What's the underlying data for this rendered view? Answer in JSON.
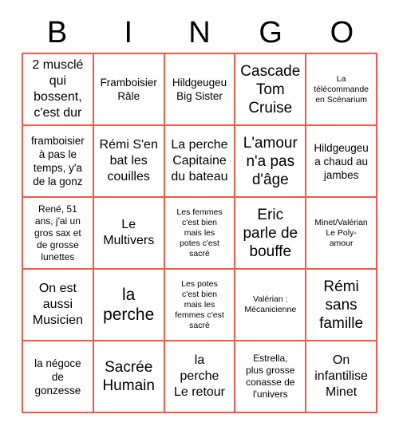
{
  "card": {
    "header_letters": [
      "B",
      "I",
      "N",
      "G",
      "O"
    ],
    "grid_border_color": "#f4564a",
    "text_color": "#000000",
    "background_color": "#ffffff",
    "columns": 5,
    "rows": 5,
    "cells": [
      {
        "text": "2 musclé\nqui\nbossent,\nc'est dur",
        "size": "sz-lg"
      },
      {
        "text": "Framboisier\nRâle",
        "size": "sz-md"
      },
      {
        "text": "Hildgeugeu\nBig Sister",
        "size": "sz-md"
      },
      {
        "text": "Cascade\nTom\nCruise",
        "size": "sz-xl"
      },
      {
        "text": "La\ntélécommande\nen Scénarium",
        "size": "sz-xs"
      },
      {
        "text": "framboisier\nà pas le\ntemps, y'a\nde la gonz",
        "size": "sz-md"
      },
      {
        "text": "Rémi S'en\nbat les\ncouilles",
        "size": "sz-lg"
      },
      {
        "text": "La perche\nCapitaine\ndu bateau",
        "size": "sz-lg"
      },
      {
        "text": "L'amour\nn'a pas\nd'âge",
        "size": "sz-xl"
      },
      {
        "text": "Hildgeugeu\na chaud au\njambes",
        "size": "sz-md"
      },
      {
        "text": "René, 51\nans, j'ai un\ngros sax et\nde grosse\nlunettes",
        "size": "sz-sm"
      },
      {
        "text": "Le\nMultivers",
        "size": "sz-lg"
      },
      {
        "text": "Les femmes\nc'est bien\nmais les\npotes c'est\nsacré",
        "size": "sz-xs"
      },
      {
        "text": "Eric\nparle de\nbouffe",
        "size": "sz-xl"
      },
      {
        "text": "Minet/Valérian\nLe Poly-\namour",
        "size": "sz-xs"
      },
      {
        "text": "On est\naussi\nMusicien",
        "size": "sz-lg"
      },
      {
        "text": "la\nperche",
        "size": "sz-xxl"
      },
      {
        "text": "Les potes\nc'est bien\nmais les\nfemmes c'est\nsacré",
        "size": "sz-xs"
      },
      {
        "text": "Valérian :\nMécanicienne",
        "size": "sz-xs"
      },
      {
        "text": "Rémi\nsans\nfamille",
        "size": "sz-xl"
      },
      {
        "text": "la négoce\nde\ngonzesse",
        "size": "sz-md"
      },
      {
        "text": "Sacrée\nHumain",
        "size": "sz-xl"
      },
      {
        "text": "la\nperche\nLe retour",
        "size": "sz-lg"
      },
      {
        "text": "Estrella,\nplus grosse\nconasse de\nl'univers",
        "size": "sz-sm"
      },
      {
        "text": "On\ninfantilise\nMinet",
        "size": "sz-lg"
      }
    ]
  }
}
